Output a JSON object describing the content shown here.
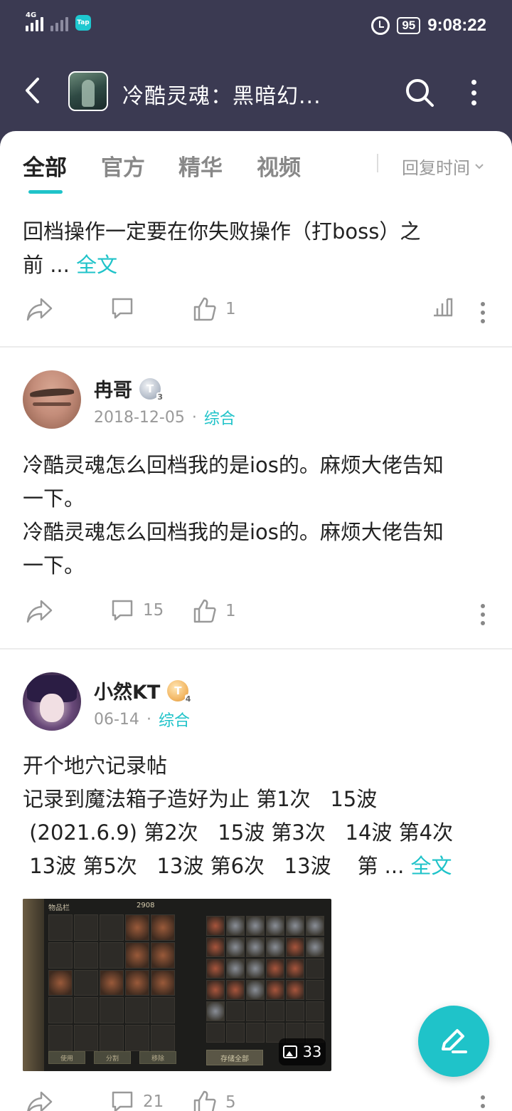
{
  "status_bar": {
    "network_label": "4G",
    "tap_label": "Tap",
    "battery": "95",
    "time": "9:08:22"
  },
  "header": {
    "title": "冷酷灵魂：黑暗幻..."
  },
  "tabs": [
    {
      "label": "全部",
      "active": true
    },
    {
      "label": "官方",
      "active": false
    },
    {
      "label": "精华",
      "active": false
    },
    {
      "label": "视频",
      "active": false
    }
  ],
  "sort": {
    "label": "回复时间"
  },
  "posts": [
    {
      "text_line1": "回档操作一定要在你失败操作（打boss）之",
      "text_line2": "前 ...",
      "read_more": "全文",
      "likes": "1"
    },
    {
      "username": "冉哥",
      "level_badge": "T",
      "level_num": "3",
      "date": "2018-12-05",
      "category": "综合",
      "lines": [
        "冷酷灵魂怎么回档我的是ios的。麻烦大佬告知",
        "一下。",
        "冷酷灵魂怎么回档我的是ios的。麻烦大佬告知",
        "一下。"
      ],
      "comments": "15",
      "likes": "1"
    },
    {
      "username": "小然KT",
      "level_badge": "T",
      "level_num": "4",
      "date": "06-14",
      "category": "综合",
      "title": "开个地穴记录帖",
      "lines": [
        "记录到魔法箱子造好为止 第1次   15波",
        " (2021.6.9) 第2次   15波 第3次   14波 第4次",
        " 13波 第5次   13波 第6次   13波    第 ..."
      ],
      "read_more": "全文",
      "image_count": "33",
      "gallery_texts": {
        "inventory": "物品栏",
        "coins": "2908",
        "use": "使用",
        "split": "分割",
        "remove": "移除",
        "store_all": "存储全部"
      },
      "comments": "21",
      "likes": "5"
    }
  ],
  "colors": {
    "accent": "#1fc3c9",
    "header_bg": "#3b3a52"
  }
}
